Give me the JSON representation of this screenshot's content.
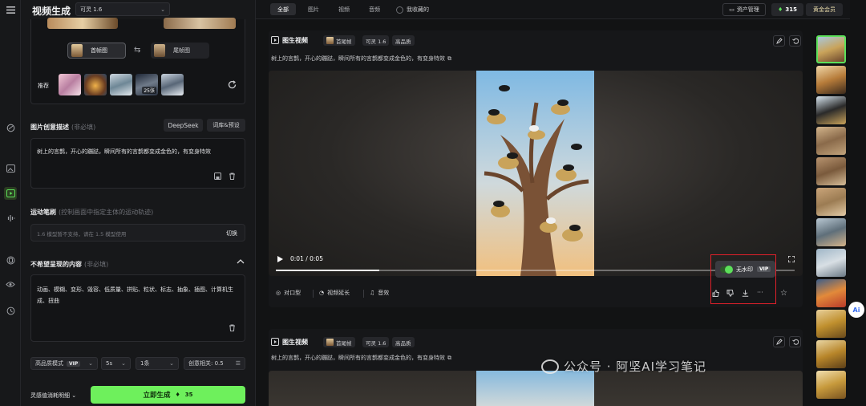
{
  "header": {
    "title": "视频生成",
    "model": "可灵 1.6"
  },
  "frames": {
    "first_label": "首帧图",
    "last_label": "尾帧图"
  },
  "recommend": {
    "label": "推荐",
    "count_badge": "25张"
  },
  "prompt_section": {
    "title": "图片创意描述",
    "optional": "(非必填)",
    "deepseek_label": "DeepSeek",
    "preset_label": "词库&预设",
    "text": "树上的言鹊，开心的蹦跶，瞬间所有的言鹊都变成金色的，有变身特效"
  },
  "motion": {
    "title": "运动笔刷",
    "hint": "(控制画面中指定主体的运动轨迹)",
    "placeholder": "1.6 模型暂不支持，请在 1.5 模型使用",
    "switch_label": "切换"
  },
  "negative": {
    "title": "不希望呈现的内容",
    "optional": "(非必填)",
    "text": "动画、模糊、变形、毁容、低质量、拼贴、粒状、标志、抽象、插图、计算机生成、扭曲"
  },
  "settings": {
    "mode": "高品质模式",
    "mode_badge": "VIP",
    "duration": "5s",
    "count": "1条",
    "relevance_label": "创意相关: 0.5"
  },
  "footer": {
    "cost_label": "灵感值消耗明细",
    "generate_label": "立即生成",
    "generate_cost": "35"
  },
  "topbar": {
    "tabs": [
      "全部",
      "图片",
      "视频",
      "音频"
    ],
    "favorites_label": "我收藏的",
    "assets_label": "资产管理",
    "credits": "315",
    "member_label": "黄金会员"
  },
  "video_cards": [
    {
      "type_label": "图生视频",
      "tags": [
        "首尾帧",
        "可灵 1.6",
        "高品质"
      ],
      "description": "树上的言鹊，开心的蹦跶，瞬间所有的言鹊都变成金色的，有变身特效",
      "time": "0:01 / 0:05",
      "progress": 0.2,
      "watermark_label": "无水印",
      "vip_badge": "VIP",
      "actions": [
        "对口型",
        "视频延长",
        "音效"
      ]
    },
    {
      "type_label": "图生视频",
      "tags": [
        "首尾帧",
        "可灵 1.6",
        "高品质"
      ],
      "description": "树上的言鹊，开心的蹦跶，瞬间所有的言鹊都变成金色的，有变身特效"
    }
  ],
  "overlay": {
    "watermark_text": "公众号 · 阿坚AI学习笔记"
  },
  "colors": {
    "accent": "#5ce05a",
    "highlight_box": "#e0202a",
    "bg": "#121314",
    "panel": "#17181a"
  },
  "icons": {
    "menu": "menu-icon",
    "refresh": "refresh-icon",
    "undo": "undo-icon",
    "edit": "edit-icon",
    "star": "star-icon",
    "like": "thumbs-up-icon",
    "dislike": "thumbs-down-icon",
    "download": "download-icon",
    "more": "more-icon",
    "fullscreen": "fullscreen-icon",
    "play": "play-icon",
    "delete": "trash-icon",
    "save": "save-icon"
  }
}
